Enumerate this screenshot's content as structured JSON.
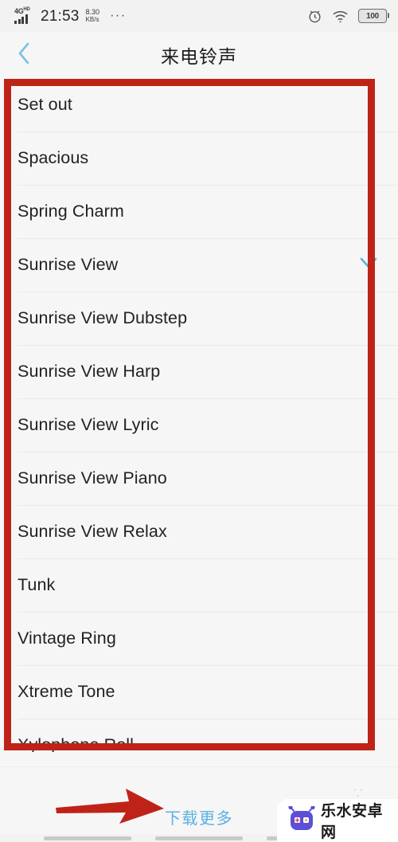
{
  "status_bar": {
    "network_type": "4G",
    "network_suffix": "HD",
    "time": "21:53",
    "speed_value": "8.30",
    "speed_unit": "KB/s",
    "overflow": "···",
    "alarm_icon": "alarm-clock-icon",
    "wifi_icon": "wifi-icon",
    "battery_level": "100"
  },
  "header": {
    "back_icon": "chevron-left-icon",
    "title": "来电铃声"
  },
  "ringtones": {
    "selected": "Sunrise View",
    "check_icon": "check-icon",
    "items": [
      {
        "label": "Set out"
      },
      {
        "label": "Spacious"
      },
      {
        "label": "Spring Charm"
      },
      {
        "label": "Sunrise View"
      },
      {
        "label": "Sunrise View Dubstep"
      },
      {
        "label": "Sunrise View Harp"
      },
      {
        "label": "Sunrise View Lyric"
      },
      {
        "label": "Sunrise View Piano"
      },
      {
        "label": "Sunrise View Relax"
      },
      {
        "label": "Tunk"
      },
      {
        "label": "Vintage Ring"
      },
      {
        "label": "Xtreme Tone"
      },
      {
        "label": "Xylophone Roll"
      }
    ]
  },
  "footer": {
    "download_more": "下载更多"
  },
  "watermark": {
    "text": "乐水安卓网",
    "ghost_text": "∵",
    "robot_icon": "robot-logo-icon"
  },
  "annotations": {
    "highlight_box": "red-rectangle-highlight",
    "pointer": "red-arrow-pointer"
  },
  "colors": {
    "accent_blue": "#5bb0e4",
    "annotation_red": "#bf2318",
    "list_bg": "#f6f6f6",
    "text_primary": "#222222",
    "watermark_purple": "#5b4fd6"
  }
}
